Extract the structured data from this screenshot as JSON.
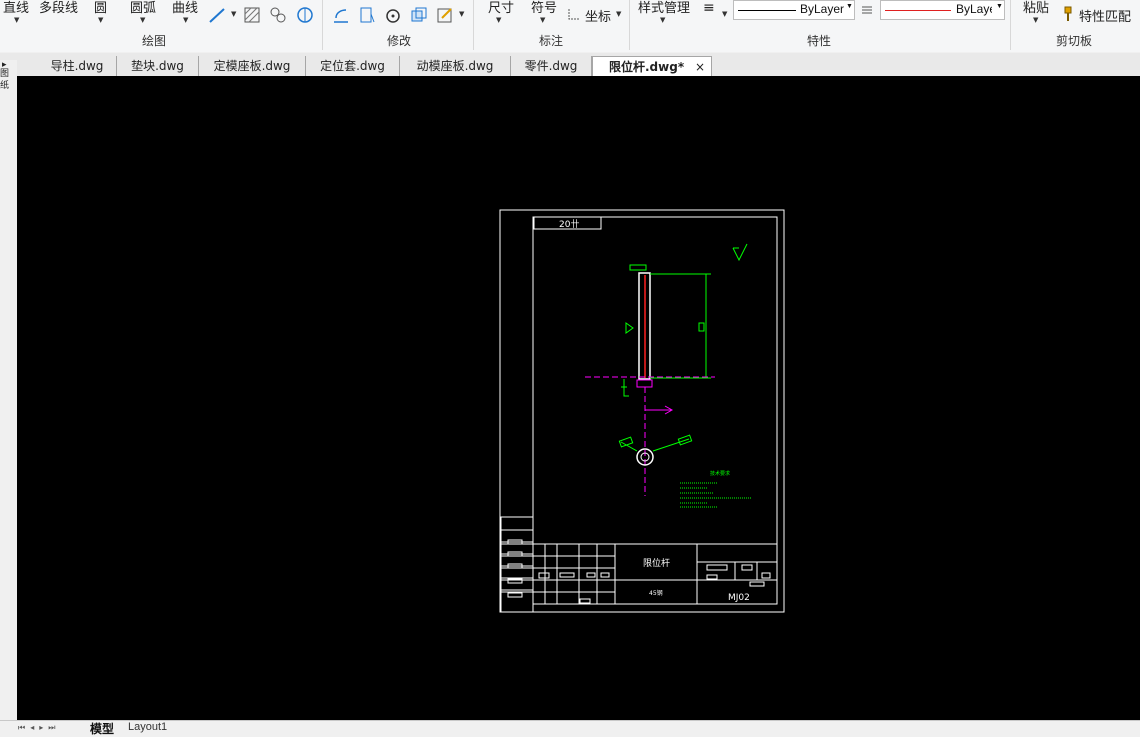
{
  "ribbon": {
    "draw_group": {
      "label": "绘图",
      "buttons": [
        "直线",
        "多段线",
        "圆",
        "圆弧",
        "曲线"
      ]
    },
    "modify_group": {
      "label": "修改"
    },
    "annotate_group": {
      "label": "标注",
      "buttons": [
        "尺寸",
        "符号",
        "坐标"
      ]
    },
    "properties_group": {
      "label": "特性",
      "style_manager": "样式管理",
      "linetype_value": "ByLayer",
      "color_value": "ByLaye"
    },
    "clipboard_group": {
      "label": "剪切板",
      "paste": "粘贴",
      "match_properties": "特性匹配"
    }
  },
  "tabs": [
    {
      "label": "导柱.dwg"
    },
    {
      "label": "垫块.dwg"
    },
    {
      "label": "定模座板.dwg"
    },
    {
      "label": "定位套.dwg"
    },
    {
      "label": "动模座板.dwg"
    },
    {
      "label": "零件.dwg"
    },
    {
      "label": "限位杆.dwg*"
    }
  ],
  "tab_close": "×",
  "left_strip_text": "图\n纸",
  "drawing": {
    "header_text": "20卄",
    "title_block_name": "限位杆",
    "title_block_sub": "45钢",
    "drawing_number": "MJ02",
    "tech_notes_title": "技术要求"
  },
  "colors": {
    "canvas": "#000000",
    "outline": "#ffffff",
    "dimension": "#00ff00",
    "centerline": "#ff00ff",
    "part": "#ff0000"
  },
  "layout_tabs": [
    {
      "label": "模型"
    },
    {
      "label": "Layout1"
    }
  ]
}
